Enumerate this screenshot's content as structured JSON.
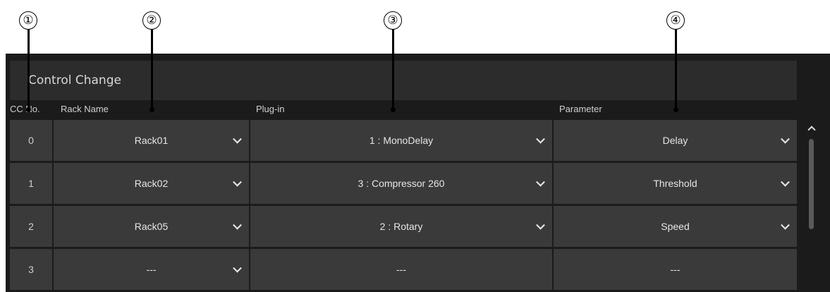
{
  "callouts": [
    "①",
    "②",
    "③",
    "④"
  ],
  "panel": {
    "title": "Control Change"
  },
  "columns": {
    "cc": "CC No.",
    "rack": "Rack Name",
    "plugin": "Plug-in",
    "parameter": "Parameter"
  },
  "rows": [
    {
      "cc": "0",
      "rack": "Rack01",
      "plugin": "1 : MonoDelay",
      "parameter": "Delay"
    },
    {
      "cc": "1",
      "rack": "Rack02",
      "plugin": "3 : Compressor 260",
      "parameter": "Threshold"
    },
    {
      "cc": "2",
      "rack": "Rack05",
      "plugin": "2 : Rotary",
      "parameter": "Speed"
    },
    {
      "cc": "3",
      "rack": "---",
      "plugin": "---",
      "parameter": "---"
    }
  ]
}
